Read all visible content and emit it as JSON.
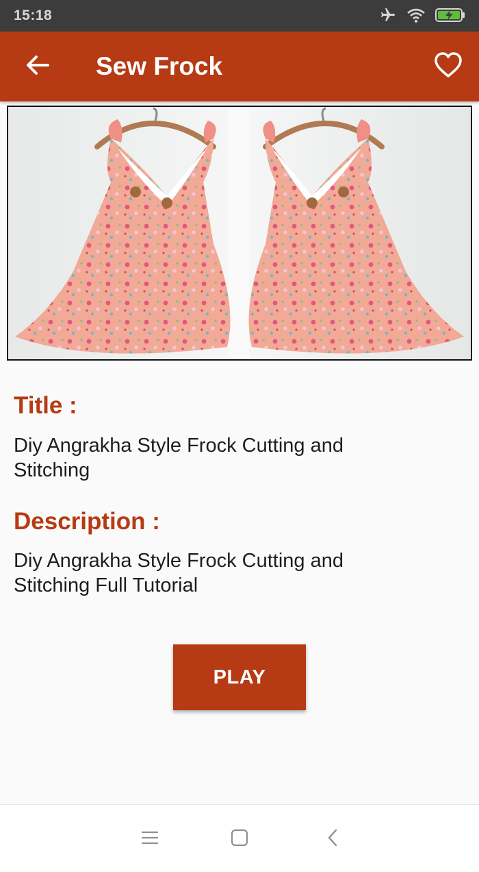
{
  "status_bar": {
    "time": "15:18",
    "icons": [
      "airplane-mode-icon",
      "wifi-icon",
      "battery-charging-icon"
    ]
  },
  "app_bar": {
    "title": "Sew Frock",
    "back_icon": "arrow-back-icon",
    "favorite_icon": "heart-outline-icon",
    "background": "#b63a13"
  },
  "hero_image": {
    "subject": "Two pink floral sleeveless frocks on wooden hangers",
    "colors": {
      "dress": "#f2a995",
      "hanger": "#b07a52",
      "wall": "#eef0ef"
    }
  },
  "details": {
    "title_label": "Title :",
    "title_value": "Diy Angrakha Style Frock Cutting and Stitching",
    "description_label": "Description :",
    "description_value": "Diy Angrakha Style Frock Cutting and Stitching Full Tutorial"
  },
  "play_button": {
    "label": "PLAY"
  },
  "nav_bar": {
    "icons": [
      "menu-icon",
      "home-square-icon",
      "back-chevron-icon"
    ]
  },
  "colors": {
    "accent": "#b63a13",
    "status_bar": "#3c3c3c",
    "text": "#1e1e1e"
  }
}
